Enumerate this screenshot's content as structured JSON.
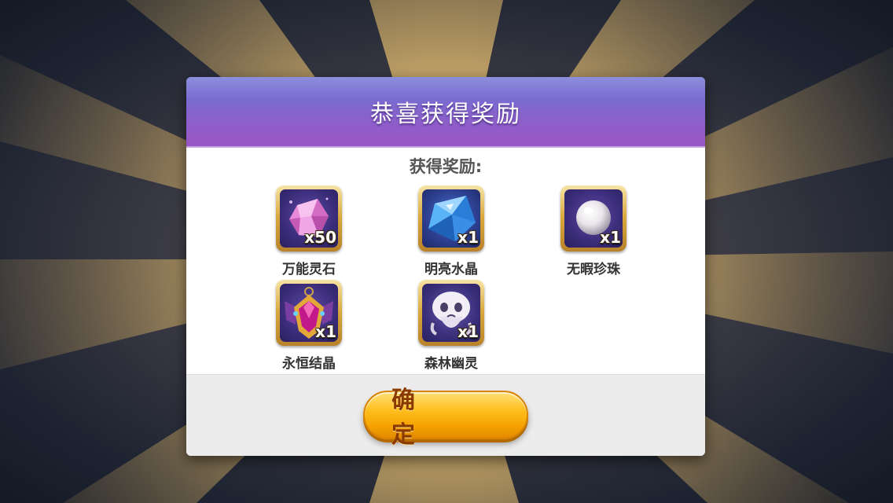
{
  "dialog": {
    "title": "恭喜获得奖励",
    "reward_heading": "获得奖励:",
    "confirm_label": "确 定"
  },
  "rewards": [
    {
      "name": "万能灵石",
      "quantity": "x50",
      "icon": "pink-crystal-icon"
    },
    {
      "name": "明亮水晶",
      "quantity": "x1",
      "icon": "blue-crystal-icon"
    },
    {
      "name": "无暇珍珠",
      "quantity": "x1",
      "icon": "pearl-icon"
    },
    {
      "name": "永恒结晶",
      "quantity": "x1",
      "icon": "winged-gem-amulet-icon"
    },
    {
      "name": "森林幽灵",
      "quantity": "x1",
      "icon": "forest-ghost-icon"
    }
  ],
  "colors": {
    "header_top": "#6b6fd2",
    "header_bottom": "#9a56c4",
    "button_gold": "#ffbf1f",
    "button_text": "#8a3a00"
  }
}
